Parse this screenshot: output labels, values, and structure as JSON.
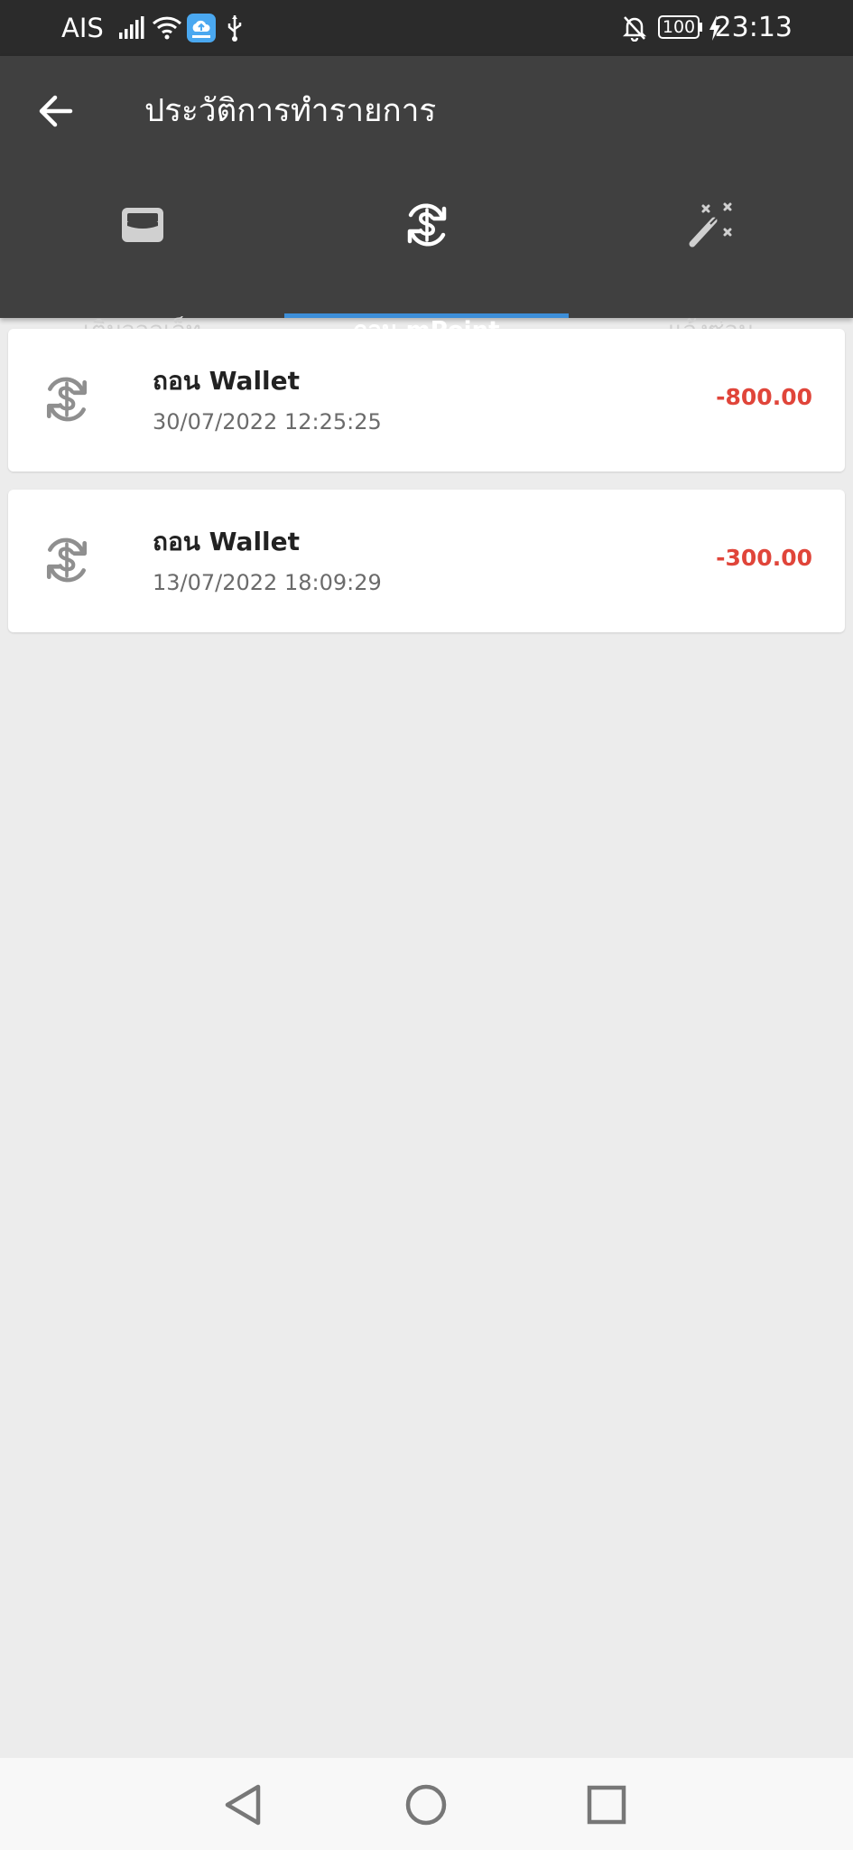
{
  "status_bar": {
    "carrier": "AIS",
    "battery": "100",
    "time": "23:13",
    "icons": [
      "signal-icon",
      "wifi-icon",
      "cloud-app-icon",
      "usb-icon",
      "bell-off-icon",
      "battery-icon",
      "charging-icon"
    ]
  },
  "header": {
    "back_icon": "arrow-left-icon",
    "title": "ประวัติการทำรายการ"
  },
  "tabs": [
    {
      "label": "เติมวอลเล็ท",
      "icon": "wallet-icon",
      "active": false
    },
    {
      "label": "ถอน mPoint",
      "icon": "dollar-exchange-icon",
      "active": true
    },
    {
      "label": "แจ้งซ่อม",
      "icon": "magic-wand-icon",
      "active": false
    }
  ],
  "transactions": [
    {
      "icon": "dollar-exchange-icon",
      "title": "ถอน Wallet",
      "datetime": "30/07/2022 12:25:25",
      "amount": "-800.00"
    },
    {
      "icon": "dollar-exchange-icon",
      "title": "ถอน Wallet",
      "datetime": "13/07/2022 18:09:29",
      "amount": "-300.00"
    }
  ],
  "nav_bar": {
    "icons": [
      "back-triangle-icon",
      "home-circle-icon",
      "recents-square-icon"
    ]
  },
  "colors": {
    "status_bar": "#2b2b2b",
    "app_bar": "#404040",
    "tab_indicator": "#3d8fd9",
    "amount_negative": "#e0453a",
    "background": "#ececec"
  }
}
